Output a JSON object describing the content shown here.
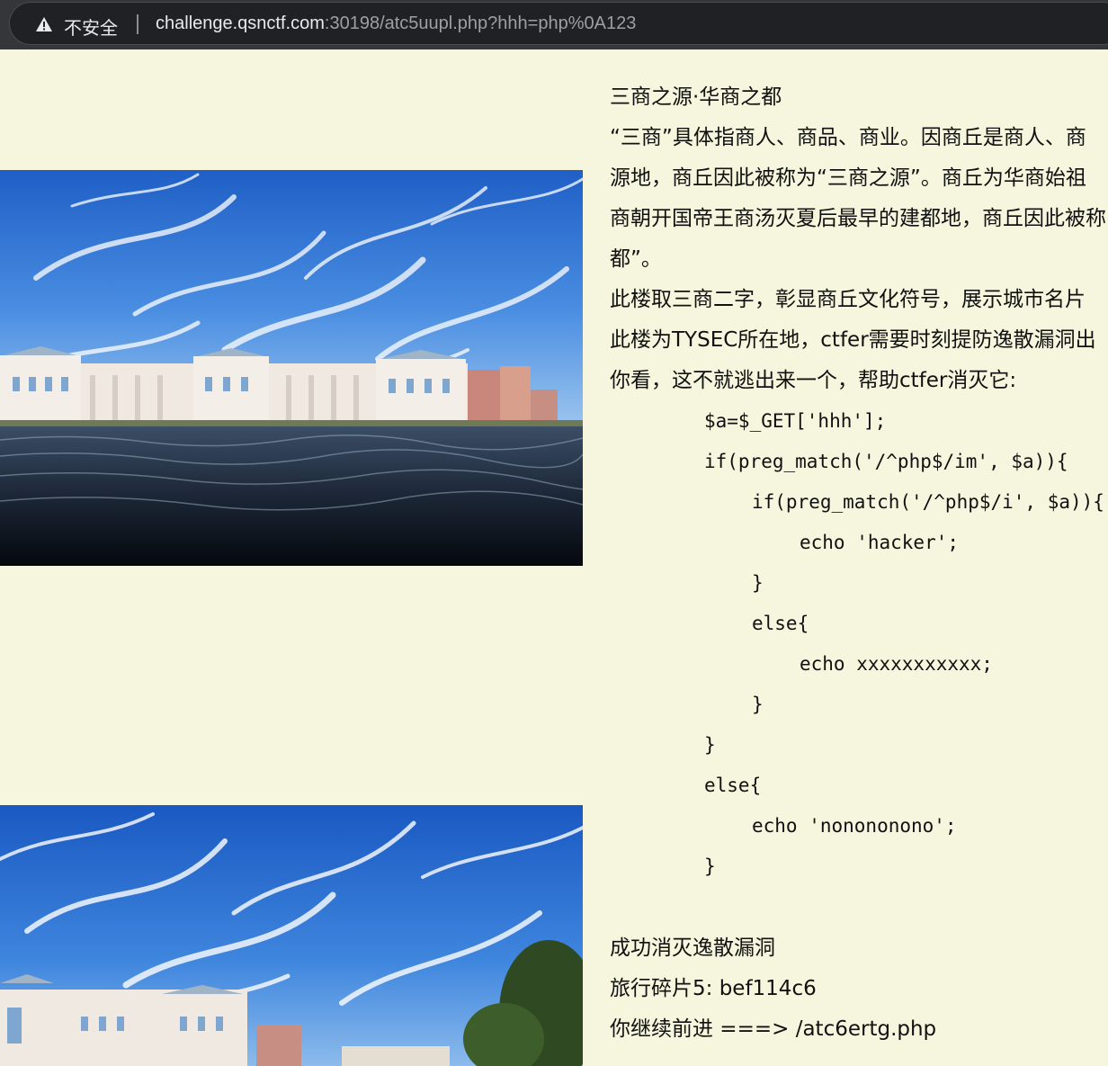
{
  "browser": {
    "security_label": "不安全",
    "url_host": "challenge.qsnctf.com",
    "url_path": ":30198/atc5uupl.php?hhh=php%0A123"
  },
  "images": {
    "photo_top": "university-building-lake-photo",
    "photo_bottom": "university-building-lake-photo"
  },
  "content": {
    "heading": "三商之源·华商之都",
    "para1_line1": "“三商”具体指商人、商品、商业。因商丘是商人、商",
    "para1_line2": "源地，商丘因此被称为“三商之源”。商丘为华商始祖",
    "para1_line3": "商朝开国帝王商汤灭夏后最早的建都地，商丘因此被称",
    "para1_line4": "都”。",
    "para2": "此楼取三商二字，彰显商丘文化符号，展示城市名片",
    "para3": "此楼为TYSEC所在地，ctfer需要时刻提防逸散漏洞出",
    "para4": "你看，这不就逃出来一个，帮助ctfer消灭它:",
    "code": [
      "$a=$_GET['hhh'];",
      "if(preg_match('/^php$/im', $a)){",
      "if(preg_match('/^php$/i', $a)){",
      "echo 'hacker';",
      "}",
      "else{",
      "echo xxxxxxxxxxx;",
      "}",
      "}",
      "else{",
      "echo 'nonononono';",
      "}"
    ],
    "result": "成功消灭逸散漏洞",
    "fragment": "旅行碎片5: bef114c6",
    "next": "你继续前进 ===> /atc6ertg.php"
  }
}
